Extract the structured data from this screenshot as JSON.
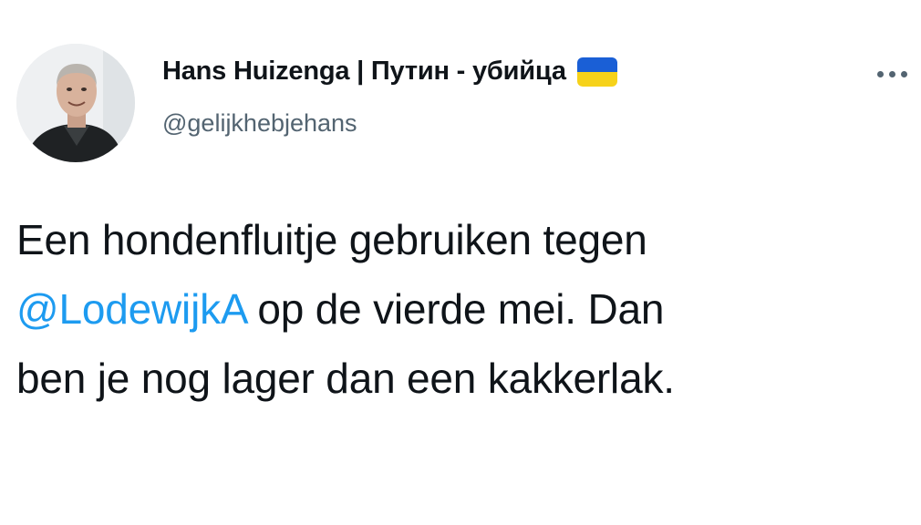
{
  "author": {
    "display_name": "Hans Huizenga | Путин - убийца",
    "handle": "@gelijkhebjehans",
    "avatar_icon": "profile-photo",
    "flag_icon": "ukraine-flag-icon",
    "flag_colors": [
      "#1a5fd6",
      "#f6d21a"
    ]
  },
  "actions": {
    "more_icon": "more-options-icon"
  },
  "tweet": {
    "line1": "Een hondenfluitje gebruiken tegen",
    "mention": "@LodewijkA",
    "line2_rest": " op de vierde mei. Dan",
    "line3": "ben je nog lager dan een kakkerlak."
  },
  "colors": {
    "text": "#0f1419",
    "secondary": "#536471",
    "link": "#1d9bf0",
    "background": "#ffffff"
  }
}
